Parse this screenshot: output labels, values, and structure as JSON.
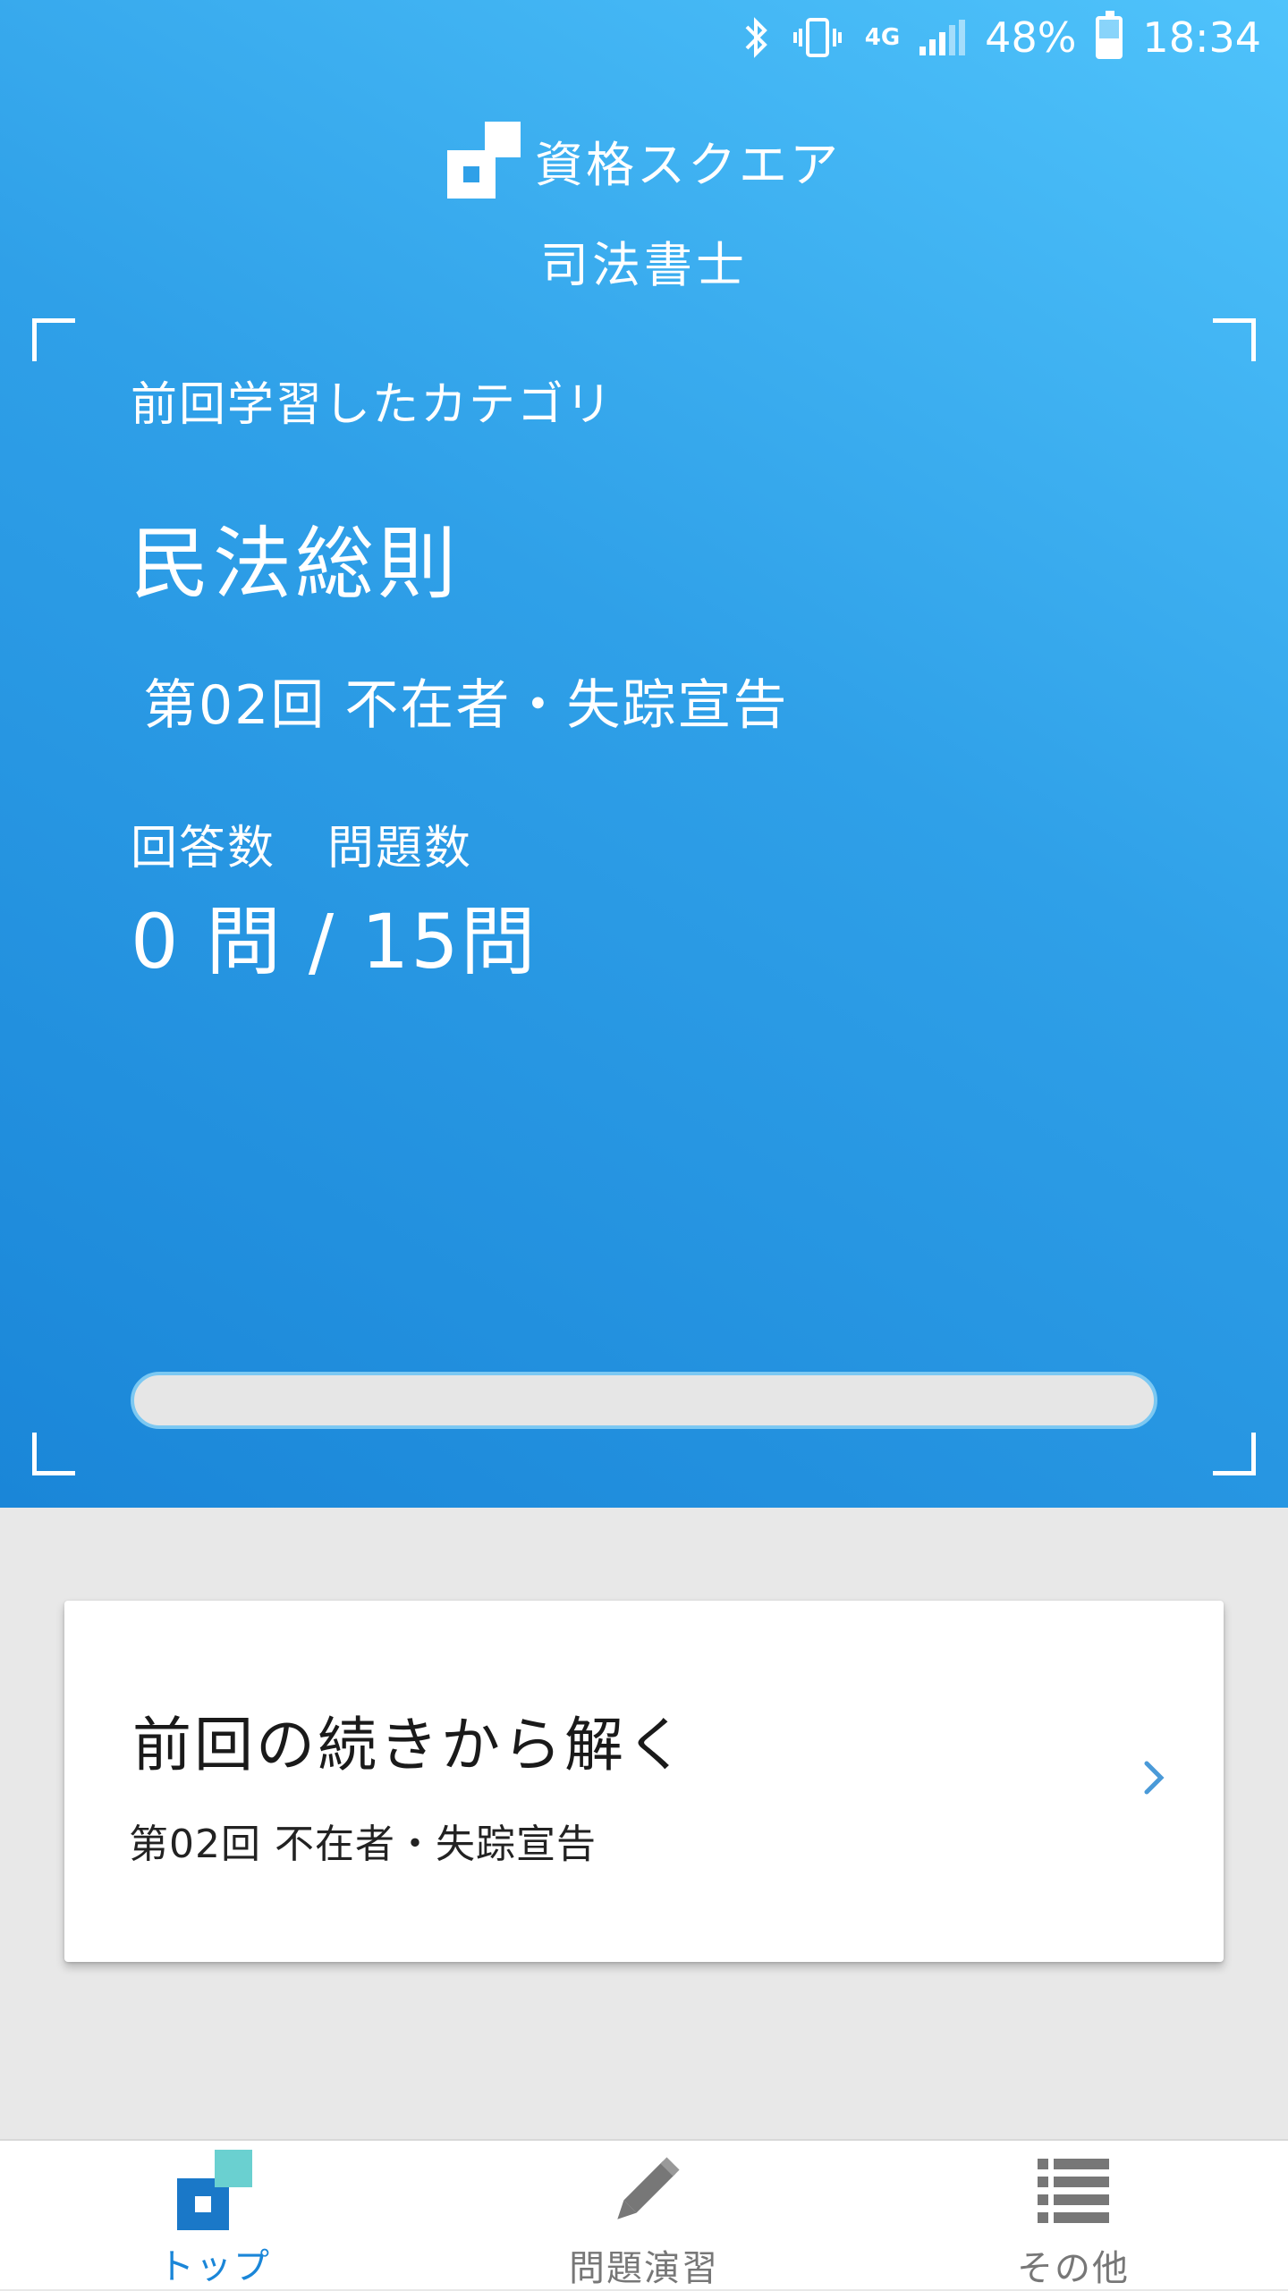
{
  "status_bar": {
    "network": "4G",
    "battery": "48%",
    "time": "18:34",
    "icons": [
      "bluetooth-icon",
      "vibrate-icon",
      "4g-icon",
      "signal-icon",
      "battery-icon"
    ]
  },
  "header": {
    "logo_text": "資格スクエア",
    "subtitle": "司法書士"
  },
  "last_study": {
    "label": "前回学習したカテゴリ",
    "category": "民法総則",
    "lesson": "第02回 不在者・失踪宣告",
    "answered_label": "回答数",
    "total_label": "問題数",
    "count_text": "0 問 / 15問",
    "progress": 0
  },
  "resume_card": {
    "title": "前回の続きから解く",
    "lesson": "第02回 不在者・失踪宣告",
    "icon": "chevron-right-icon"
  },
  "bottom_nav": {
    "items": [
      {
        "label": "トップ",
        "icon": "home-logo-icon",
        "active": true
      },
      {
        "label": "問題演習",
        "icon": "pencil-icon",
        "active": false
      },
      {
        "label": "その他",
        "icon": "list-icon",
        "active": false
      }
    ]
  },
  "colors": {
    "hero_gradient_start": "#4fc3fb",
    "hero_gradient_end": "#1a86d8",
    "accent": "#1a86d8",
    "nav_inactive": "#777777",
    "chevron": "#4a9ad8"
  }
}
